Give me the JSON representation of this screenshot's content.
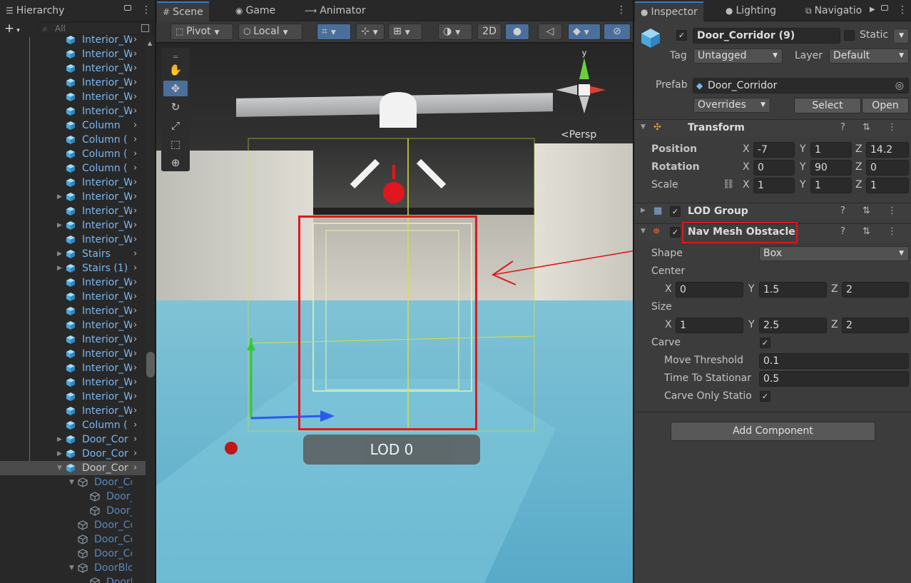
{
  "hierarchy": {
    "tab": "Hierarchy",
    "search_placeholder": "All",
    "rows": [
      {
        "label": "Interior_W",
        "kind": "prefab"
      },
      {
        "label": "Interior_W",
        "kind": "prefab"
      },
      {
        "label": "Interior_W",
        "kind": "prefab"
      },
      {
        "label": "Interior_W",
        "kind": "prefab"
      },
      {
        "label": "Interior_W",
        "kind": "prefab"
      },
      {
        "label": "Interior_W",
        "kind": "prefab"
      },
      {
        "label": "Column",
        "kind": "prefab"
      },
      {
        "label": "Column (",
        "kind": "prefab"
      },
      {
        "label": "Column (",
        "kind": "prefab"
      },
      {
        "label": "Column (",
        "kind": "prefab"
      },
      {
        "label": "Interior_W",
        "kind": "prefab"
      },
      {
        "label": "Interior_W",
        "kind": "prefab",
        "expand": "closed"
      },
      {
        "label": "Interior_W",
        "kind": "prefab"
      },
      {
        "label": "Interior_W",
        "kind": "prefab",
        "expand": "closed"
      },
      {
        "label": "Interior_W",
        "kind": "prefab"
      },
      {
        "label": "Stairs",
        "kind": "prefab",
        "expand": "closed"
      },
      {
        "label": "Stairs (1)",
        "kind": "prefab",
        "expand": "closed"
      },
      {
        "label": "Interior_W",
        "kind": "prefab"
      },
      {
        "label": "Interior_W",
        "kind": "prefab"
      },
      {
        "label": "Interior_W",
        "kind": "prefab"
      },
      {
        "label": "Interior_W",
        "kind": "prefab"
      },
      {
        "label": "Interior_W",
        "kind": "prefab"
      },
      {
        "label": "Interior_W",
        "kind": "prefab"
      },
      {
        "label": "Interior_W",
        "kind": "prefab"
      },
      {
        "label": "Interior_W",
        "kind": "prefab"
      },
      {
        "label": "Interior_W",
        "kind": "prefab"
      },
      {
        "label": "Interior_W",
        "kind": "prefab"
      },
      {
        "label": "Column (",
        "kind": "prefab"
      },
      {
        "label": "Door_Cor",
        "kind": "prefab",
        "expand": "closed"
      },
      {
        "label": "Door_Cor",
        "kind": "prefab",
        "expand": "closed"
      },
      {
        "label": "Door_Cor",
        "kind": "prefab",
        "expand": "open",
        "selected": true
      },
      {
        "label": "Door_Corr",
        "kind": "child",
        "expand": "open",
        "depth": 1
      },
      {
        "label": "Door_C",
        "kind": "child",
        "depth": 2
      },
      {
        "label": "Door_C",
        "kind": "child",
        "depth": 2
      },
      {
        "label": "Door_Corr",
        "kind": "child",
        "depth": 1
      },
      {
        "label": "Door_Corr",
        "kind": "child",
        "depth": 1
      },
      {
        "label": "Door_Corr",
        "kind": "child",
        "depth": 1
      },
      {
        "label": "DoorBlock",
        "kind": "child",
        "expand": "open",
        "depth": 1
      },
      {
        "label": "DoorBlo",
        "kind": "child",
        "depth": 2
      }
    ]
  },
  "scene": {
    "tabs": [
      "Scene",
      "Game",
      "Animator"
    ],
    "toolbar": {
      "pivot": "Pivot",
      "local": "Local",
      "two_d": "2D"
    },
    "persp_label": "<Persp",
    "lod_label": "LOD 0",
    "gizmo": {
      "y": "y",
      "x": "x"
    }
  },
  "inspector": {
    "tabs": [
      "Inspector",
      "Lighting",
      "Navigatio"
    ],
    "object_name": "Door_Corridor (9)",
    "static_label": "Static",
    "tag_label": "Tag",
    "tag_value": "Untagged",
    "layer_label": "Layer",
    "layer_value": "Default",
    "prefab_label": "Prefab",
    "prefab_value": "Door_Corridor",
    "overrides": "Overrides",
    "select": "Select",
    "open": "Open",
    "transform": {
      "title": "Transform",
      "position_label": "Position",
      "rotation_label": "Rotation",
      "scale_label": "Scale",
      "position": [
        "-7",
        "1",
        "14.2"
      ],
      "rotation": [
        "0",
        "90",
        "0"
      ],
      "scale": [
        "1",
        "1",
        "1"
      ]
    },
    "lod_group": {
      "title": "LOD Group"
    },
    "nav": {
      "title": "Nav Mesh Obstacle",
      "shape_label": "Shape",
      "shape_value": "Box",
      "center_label": "Center",
      "center": [
        "0",
        "1.5",
        "2"
      ],
      "size_label": "Size",
      "size": [
        "1",
        "2.5",
        "2"
      ],
      "carve_label": "Carve",
      "move_threshold_label": "Move Threshold",
      "move_threshold": "0.1",
      "time_label": "Time To Stationar",
      "time_value": "0.5",
      "carve_only_label": "Carve Only Statio"
    },
    "add_component": "Add Component",
    "axis": {
      "x": "X",
      "y": "Y",
      "z": "Z"
    }
  }
}
